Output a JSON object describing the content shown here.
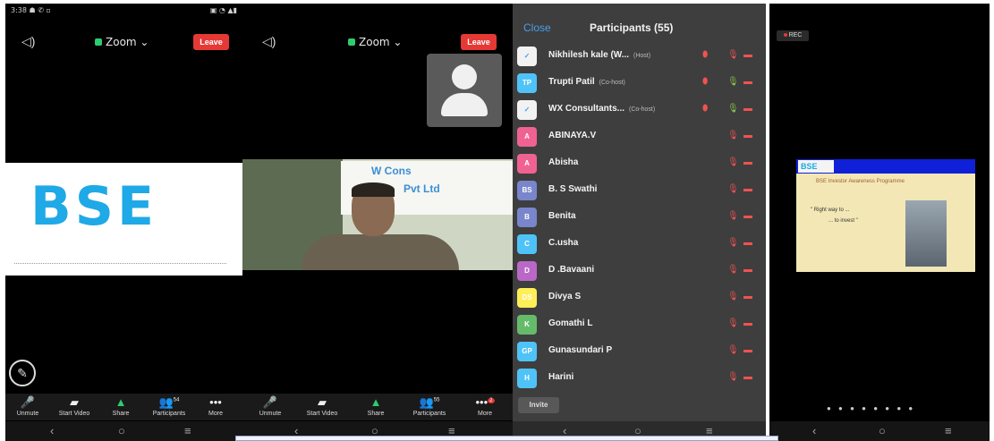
{
  "phone1": {
    "status_left": "3:38 ☗ ✆ ▫",
    "status_right": "▣ ◔ ▲▮",
    "zoom_label": "Zoom ⌄",
    "leave_label": "Leave",
    "bse_logo": "BSE",
    "toolbar": [
      {
        "label": "Unmute",
        "icon": "mic-off-icon"
      },
      {
        "label": "Start Video",
        "icon": "video-off-icon"
      },
      {
        "label": "Share",
        "icon": "share-icon"
      },
      {
        "label": "Participants",
        "icon": "participants-icon",
        "badge": "54"
      },
      {
        "label": "More",
        "icon": "more-icon"
      }
    ]
  },
  "phone2": {
    "zoom_label": "Zoom ⌄",
    "leave_label": "Leave",
    "video_sign_line1": "W  Cons",
    "video_sign_line2": "Pvt Ltd",
    "toolbar": [
      {
        "label": "Unmute",
        "icon": "mic-off-icon"
      },
      {
        "label": "Start Video",
        "icon": "video-off-icon"
      },
      {
        "label": "Share",
        "icon": "share-icon"
      },
      {
        "label": "Participants",
        "icon": "participants-icon",
        "badge": "55"
      },
      {
        "label": "More",
        "icon": "more-icon",
        "badge": "2"
      }
    ]
  },
  "participants_panel": {
    "close_label": "Close",
    "title": "Participants (55)",
    "invite_label": "Invite",
    "participants": [
      {
        "initials": "✓",
        "name": "Nikhilesh kale (W...",
        "tag": "(Host)",
        "avatar_color": "#f2f2f2",
        "video_off": true,
        "mic_on": false
      },
      {
        "initials": "TP",
        "name": "Trupti Patil",
        "tag": "(Co-host)",
        "avatar_color": "#4fc3f7",
        "video_off": true,
        "mic_on": true
      },
      {
        "initials": "✓",
        "name": "WX Consultants...",
        "tag": "(Co-host)",
        "avatar_color": "#f2f2f2",
        "video_off": true,
        "mic_on": true
      },
      {
        "initials": "A",
        "name": "ABINAYA.V",
        "tag": "",
        "avatar_color": "#f06292",
        "video_off": false,
        "mic_on": false
      },
      {
        "initials": "A",
        "name": "Abisha",
        "tag": "",
        "avatar_color": "#f06292",
        "video_off": false,
        "mic_on": false
      },
      {
        "initials": "BS",
        "name": "B. S Swathi",
        "tag": "",
        "avatar_color": "#7986cb",
        "video_off": false,
        "mic_on": false
      },
      {
        "initials": "B",
        "name": "Benita",
        "tag": "",
        "avatar_color": "#7986cb",
        "video_off": false,
        "mic_on": false
      },
      {
        "initials": "C",
        "name": "C.usha",
        "tag": "",
        "avatar_color": "#4fc3f7",
        "video_off": false,
        "mic_on": false
      },
      {
        "initials": "D",
        "name": "D .Bavaani",
        "tag": "",
        "avatar_color": "#ba68c8",
        "video_off": false,
        "mic_on": false
      },
      {
        "initials": "DS",
        "name": "Divya S",
        "tag": "",
        "avatar_color": "#ffee58",
        "video_off": false,
        "mic_on": false
      },
      {
        "initials": "K",
        "name": "Gomathi L",
        "tag": "",
        "avatar_color": "#66bb6a",
        "video_off": false,
        "mic_on": false
      },
      {
        "initials": "GP",
        "name": "Gunasundari P",
        "tag": "",
        "avatar_color": "#4fc3f7",
        "video_off": false,
        "mic_on": false
      },
      {
        "initials": "H",
        "name": "Harini",
        "tag": "",
        "avatar_color": "#4fc3f7",
        "video_off": false,
        "mic_on": false
      }
    ]
  },
  "phone4": {
    "rec_label": "REC",
    "slide_logo": "BSE",
    "slide_title": "BSE Investor Awareness Programme",
    "slide_quote1": "\" Right way to ...",
    "slide_quote2": "... to invest \"",
    "page_dots": "● ● ● ● ● ● ● ●"
  },
  "nav": {
    "back": "‹",
    "home": "○",
    "recents": "≡"
  },
  "colors": {
    "leave": "#e53935",
    "link": "#4a9ee8",
    "mic_muted": "#ef5350",
    "mic_on": "#8bc34a"
  }
}
